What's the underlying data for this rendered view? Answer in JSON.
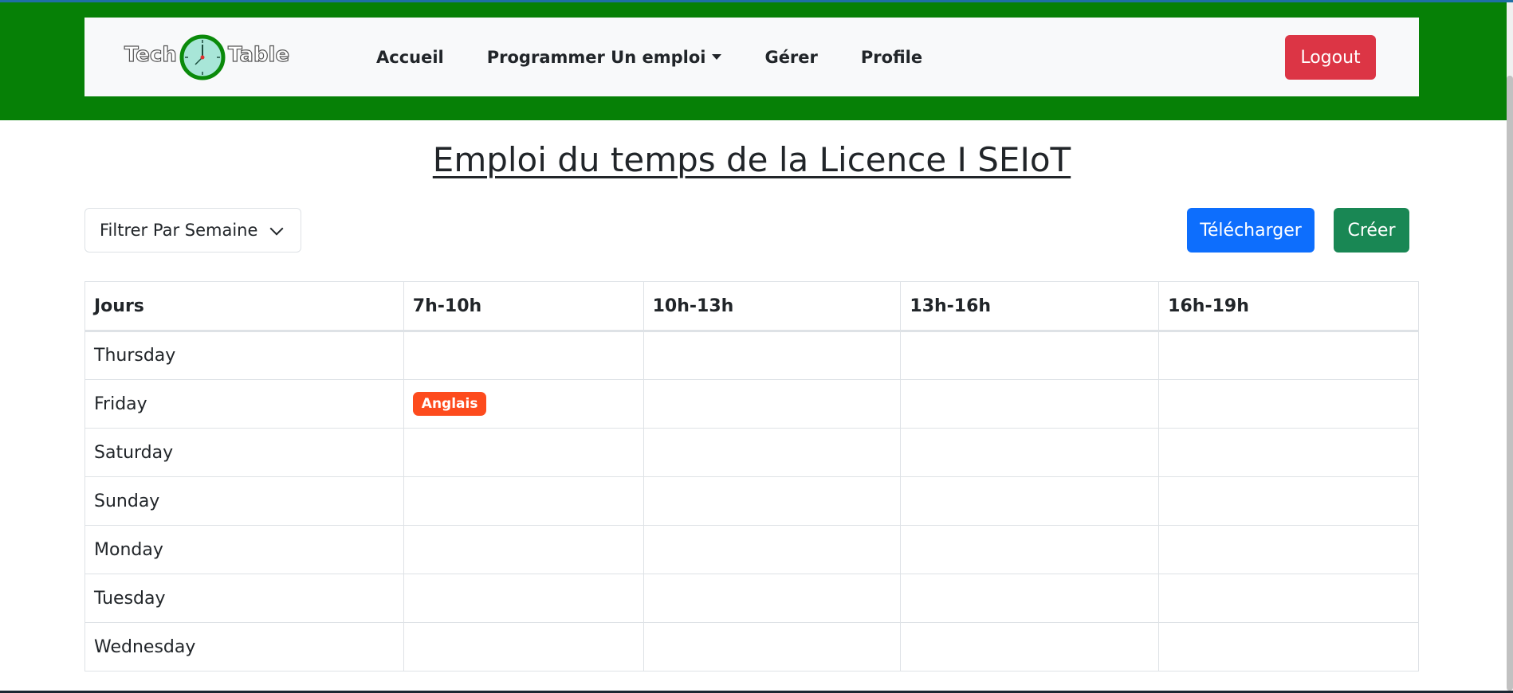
{
  "logo": {
    "word_left": "Tech",
    "word_right": "Table",
    "icon": "clock-icon"
  },
  "nav": {
    "items": [
      {
        "label": "Accueil"
      },
      {
        "label": "Programmer Un emploi",
        "dropdown": true
      },
      {
        "label": "Gérer"
      },
      {
        "label": "Profile"
      }
    ],
    "logout_label": "Logout"
  },
  "page": {
    "title": "Emploi du temps de la Licence I SEIoT",
    "filter_label": "Filtrer Par Semaine",
    "download_label": "Télécharger",
    "create_label": "Créer"
  },
  "timetable": {
    "headers": [
      "Jours",
      "7h-10h",
      "10h-13h",
      "13h-16h",
      "16h-19h"
    ],
    "rows": [
      {
        "day": "Thursday",
        "slots": [
          "",
          "",
          "",
          ""
        ]
      },
      {
        "day": "Friday",
        "slots": [
          "Anglais",
          "",
          "",
          ""
        ]
      },
      {
        "day": "Saturday",
        "slots": [
          "",
          "",
          "",
          ""
        ]
      },
      {
        "day": "Sunday",
        "slots": [
          "",
          "",
          "",
          ""
        ]
      },
      {
        "day": "Monday",
        "slots": [
          "",
          "",
          "",
          ""
        ]
      },
      {
        "day": "Tuesday",
        "slots": [
          "",
          "",
          "",
          ""
        ]
      },
      {
        "day": "Wednesday",
        "slots": [
          "",
          "",
          "",
          ""
        ]
      }
    ]
  },
  "colors": {
    "header_band": "#068006",
    "logout": "#dc3545",
    "download": "#0d6efd",
    "create": "#198754",
    "course_badge": "#fd4b1d"
  }
}
